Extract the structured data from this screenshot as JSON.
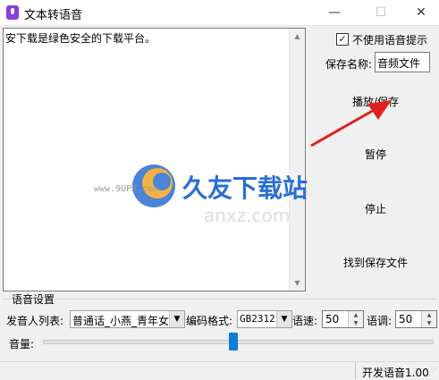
{
  "window": {
    "title": "文本转语音",
    "minimize": "—",
    "maximize": "☐",
    "close": "✕"
  },
  "text_area": {
    "content": "安下载是绿色安全的下载平台。"
  },
  "options": {
    "no_voice_hint_label": "不使用语音提示",
    "no_voice_hint_checked": true
  },
  "save": {
    "name_label": "保存名称:",
    "name_value": "音频文件"
  },
  "buttons": {
    "play_save": "播放/保存",
    "pause": "暂停",
    "stop": "停止",
    "find_file": "找到保存文件"
  },
  "voice_settings": {
    "group_title": "语音设置",
    "speaker_label": "发音人列表:",
    "speaker_value": "普通话_小燕_青年女",
    "encoding_label": "编码格式:",
    "encoding_value": "GB2312",
    "speed_label": "语速:",
    "speed_value": "50",
    "pitch_label": "语调:",
    "pitch_value": "50",
    "volume_label": "音量:",
    "volume_level_fraction": 0.49
  },
  "status": {
    "text": "开发语音1.00"
  },
  "watermark": {
    "brand": "久友下载站",
    "url": "www.9UPK.com",
    "url2": "anxz.com"
  },
  "colors": {
    "accent": "#0a7dd8",
    "arrow": "#e02020",
    "watermark_orange": "#f5a623",
    "watermark_blue": "#2a6fd1"
  }
}
